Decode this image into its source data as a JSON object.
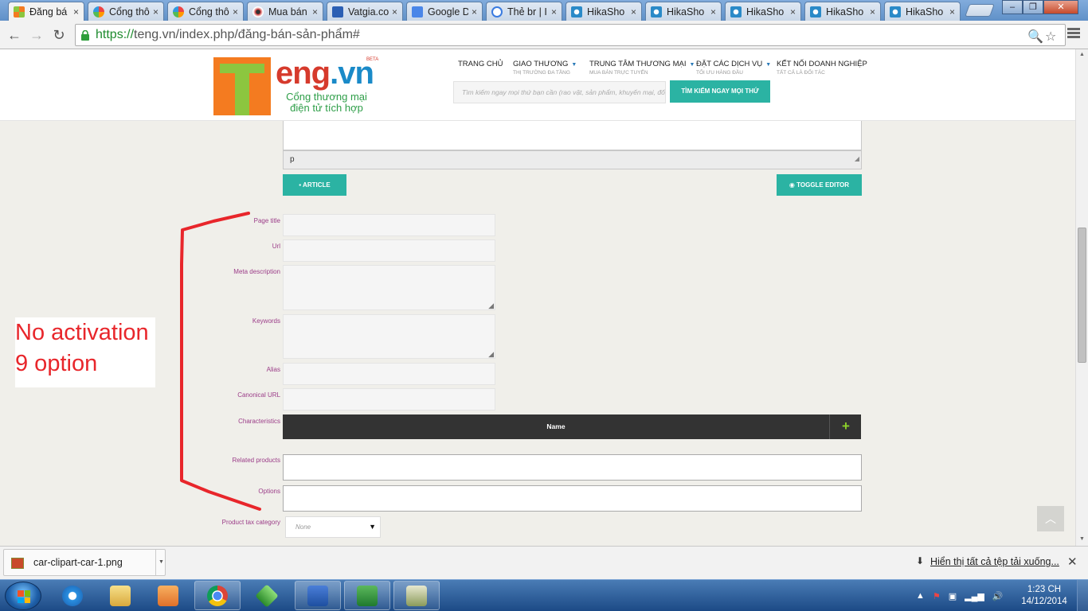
{
  "browser": {
    "tabs": [
      {
        "title": "Đăng bá",
        "active": true,
        "icon": "teng-favicon"
      },
      {
        "title": "Cổng thô",
        "active": false,
        "icon": "joomla-favicon"
      },
      {
        "title": "Cổng thô",
        "active": false,
        "icon": "joomla-favicon"
      },
      {
        "title": "Mua bán",
        "active": false,
        "icon": "eye-favicon"
      },
      {
        "title": "Vatgia.co",
        "active": false,
        "icon": "vatgia-favicon"
      },
      {
        "title": "Google D",
        "active": false,
        "icon": "translate-favicon"
      },
      {
        "title": "Thẻ br | I",
        "active": false,
        "icon": "g-favicon"
      },
      {
        "title": "HikaSho",
        "active": false,
        "icon": "hikashop-favicon"
      },
      {
        "title": "HikaSho",
        "active": false,
        "icon": "hikashop-favicon"
      },
      {
        "title": "HikaSho",
        "active": false,
        "icon": "hikashop-favicon"
      },
      {
        "title": "HikaSho",
        "active": false,
        "icon": "hikashop-favicon"
      },
      {
        "title": "HikaSho",
        "active": false,
        "icon": "hikashop-favicon"
      }
    ],
    "tab_close_glyph": "×",
    "url_scheme": "https://",
    "url_rest": "teng.vn/index.php/đăng-bán-sản-phẩm#",
    "window_controls": [
      "–",
      "❐",
      "✕"
    ]
  },
  "site": {
    "logo_text": "eng",
    "logo_dot": ".vn",
    "logo_beta": "BETA",
    "logo_sub_1": "Cổng thương mại",
    "logo_sub_2": "điện tử tích hợp",
    "nav": [
      {
        "label": "TRANG CHỦ",
        "sub": "",
        "caret": false
      },
      {
        "label": "GIAO THƯƠNG",
        "sub": "THỊ TRƯỜNG ĐA TẦNG",
        "caret": true
      },
      {
        "label": "TRUNG TÂM THƯƠNG MẠI",
        "sub": "MUA BÁN TRỰC TUYẾN",
        "caret": true
      },
      {
        "label": "ĐẶT CÁC DỊCH VỤ",
        "sub": "TỐI ƯU HÀNG ĐẦU",
        "caret": true
      },
      {
        "label": "KẾT NỐI DOANH NGHIỆP",
        "sub": "TẤT CẢ LÀ ĐỐI TÁC",
        "caret": false
      }
    ],
    "search_placeholder": "Tìm kiếm ngay mọi thứ bạn cần (rao vặt, sản phẩm, khuyến mại, đối tác...",
    "search_button": "TÌM KIẾM NGAY MỌI THỨ"
  },
  "editor": {
    "path_label": "p",
    "article_button": "ARTICLE",
    "toggle_button": "TOGGLE EDITOR"
  },
  "form": {
    "page_title_label": "Page title",
    "url_label": "Url",
    "meta_description_label": "Meta description",
    "keywords_label": "Keywords",
    "alias_label": "Alias",
    "canonical_url_label": "Canonical URL",
    "characteristics_label": "Characteristics",
    "characteristics_name_header": "Name",
    "characteristics_add": "+",
    "related_products_label": "Related products",
    "options_label": "Options",
    "product_tax_category_label": "Product tax category",
    "product_tax_category_value": "None"
  },
  "annotation": {
    "line1": "No activation",
    "line2": "9 option",
    "color": "#e8262b"
  },
  "downloads": {
    "file_name": "car-clipart-car-1.png",
    "show_all": "Hiển thị tất cả tệp tải xuống..."
  },
  "taskbar": {
    "time": "1:23 CH",
    "date": "14/12/2014",
    "apps": [
      "internet-explorer",
      "file-explorer",
      "media-player",
      "chrome",
      "idm",
      "word",
      "excel",
      "tool"
    ]
  }
}
